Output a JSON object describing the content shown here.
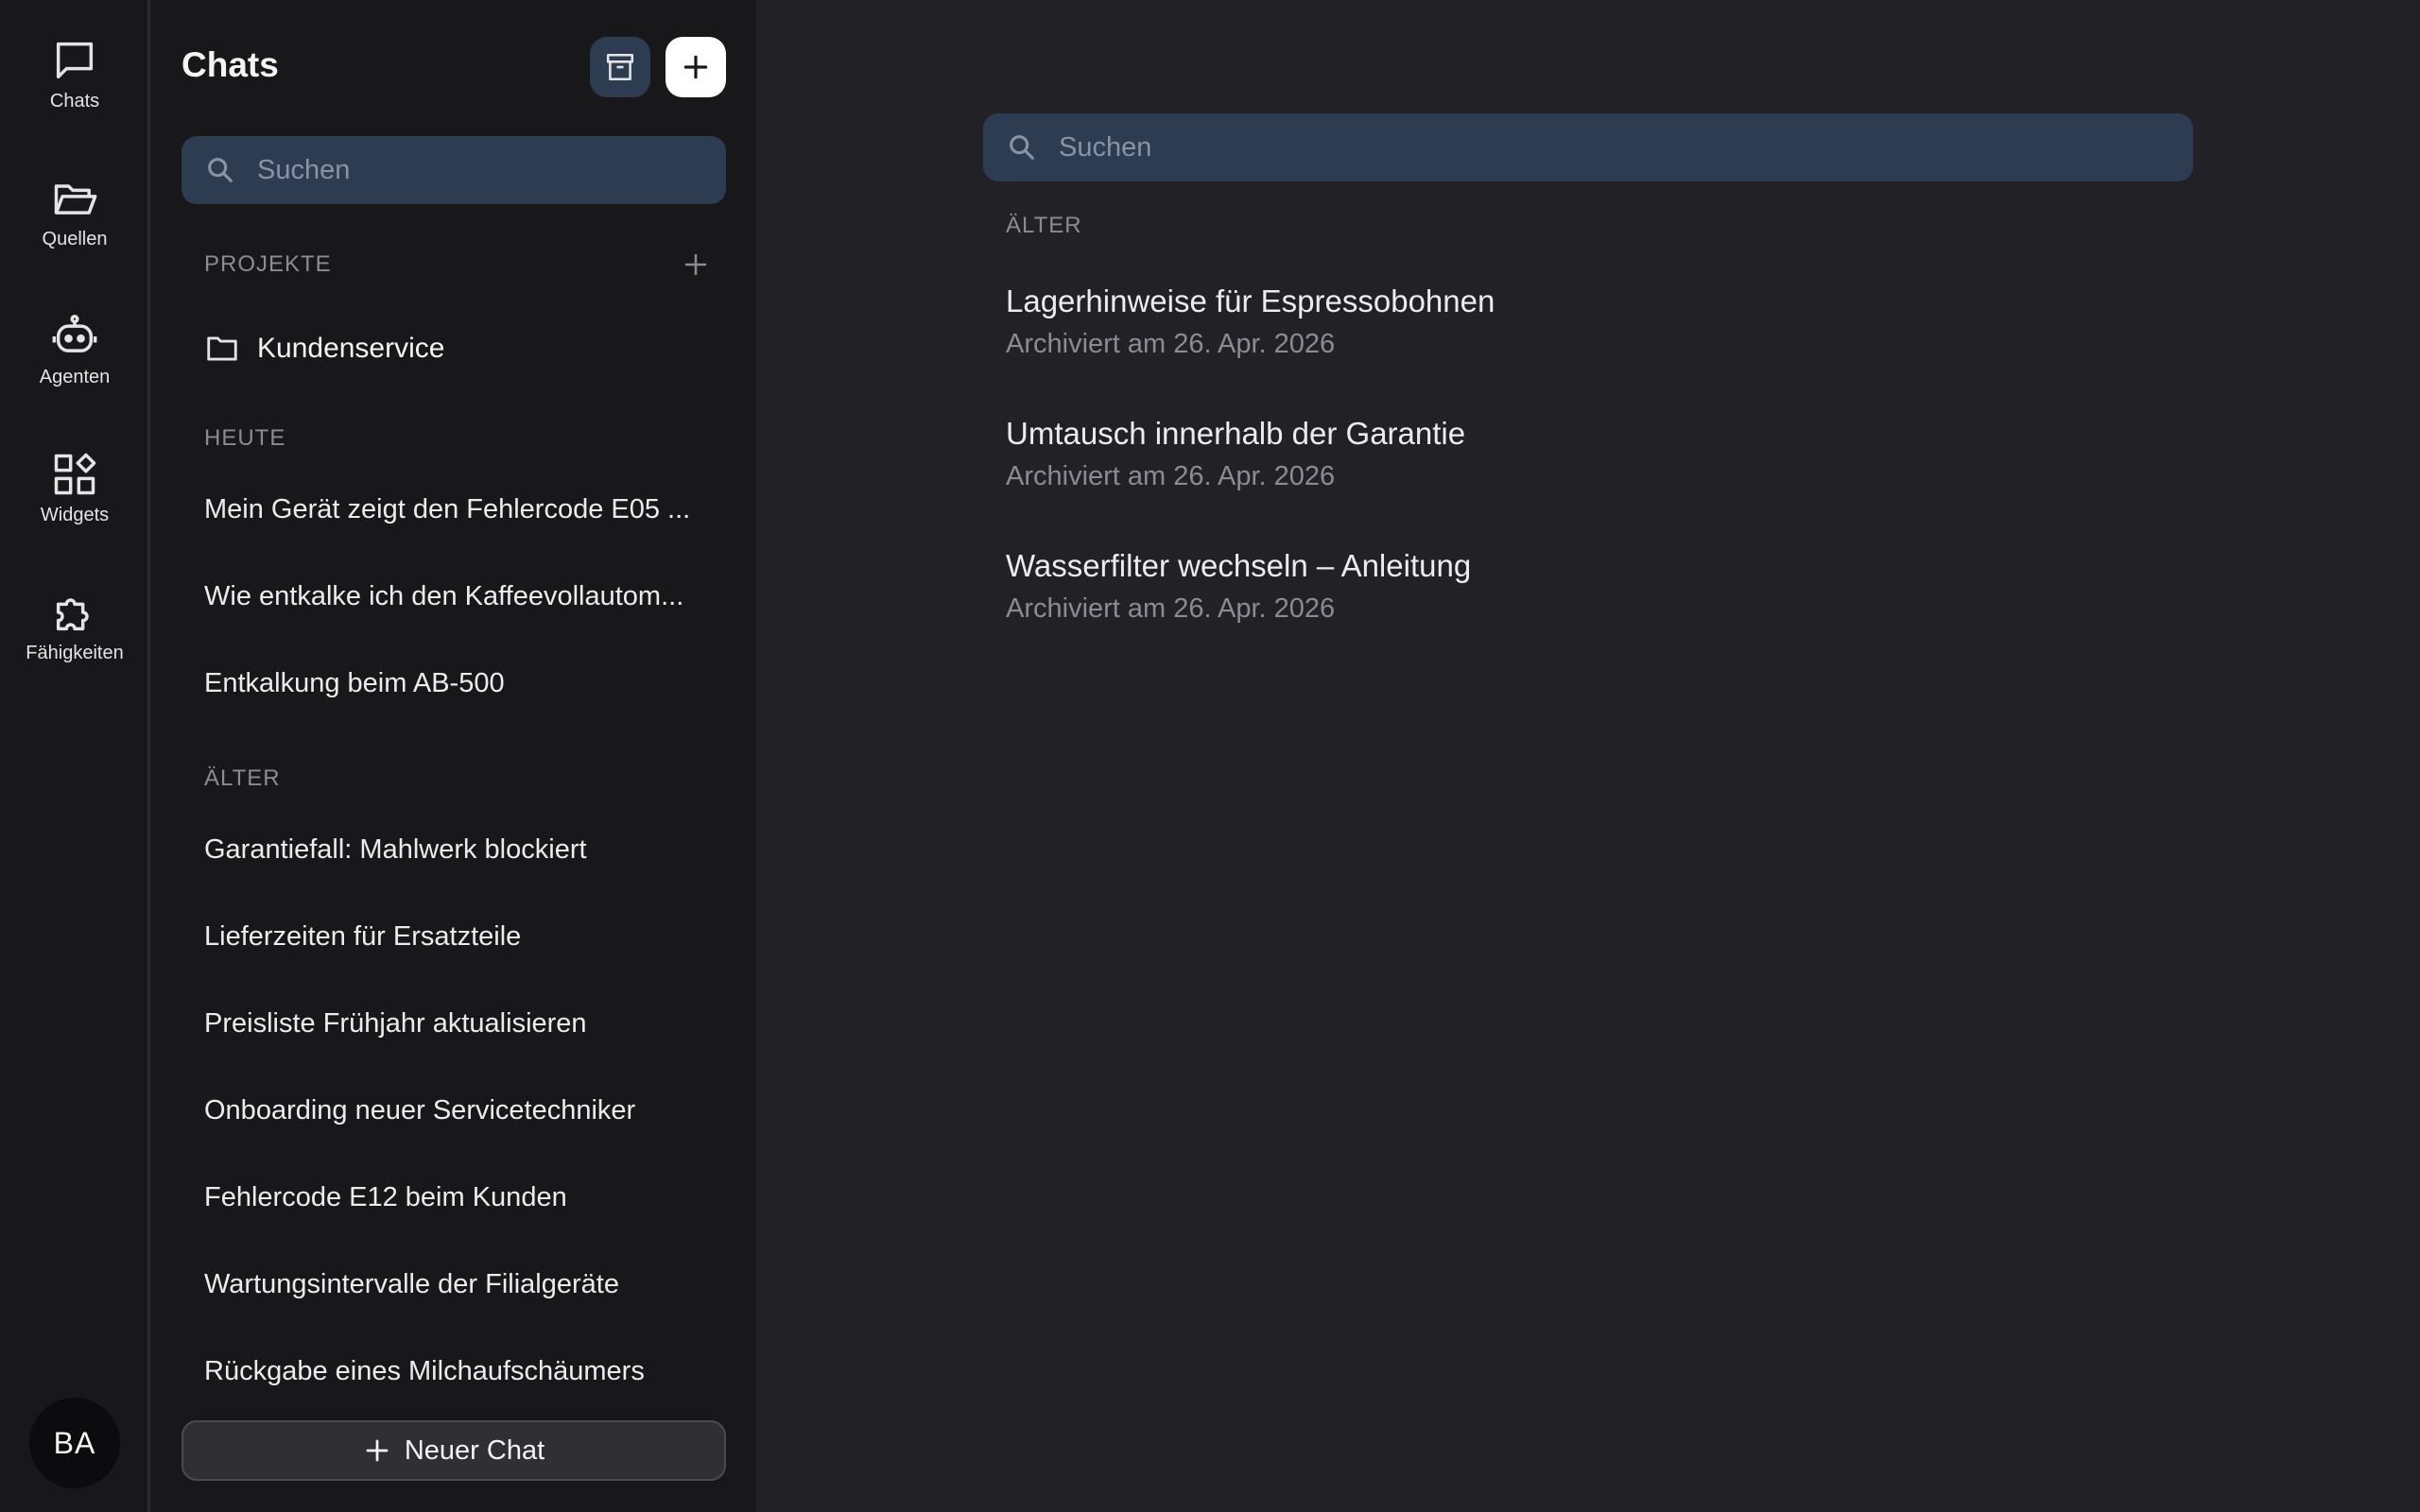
{
  "rail": {
    "items": [
      {
        "label": "Chats",
        "icon": "chat-bubble-icon"
      },
      {
        "label": "Quellen",
        "icon": "folder-open-icon"
      },
      {
        "label": "Agenten",
        "icon": "robot-icon"
      },
      {
        "label": "Widgets",
        "icon": "widgets-icon"
      },
      {
        "label": "Fähigkeiten",
        "icon": "puzzle-icon"
      }
    ],
    "avatar": "BA"
  },
  "sidebar": {
    "title": "Chats",
    "search_placeholder": "Suchen",
    "projects_label": "PROJEKTE",
    "project": "Kundenservice",
    "today_label": "HEUTE",
    "today": [
      "Mein Gerät zeigt den Fehlercode E05 ...",
      "Wie entkalke ich den Kaffeevollautom...",
      "Entkalkung beim AB-500"
    ],
    "older_label": "ÄLTER",
    "older": [
      "Garantiefall: Mahlwerk blockiert",
      "Lieferzeiten für Ersatzteile",
      "Preisliste Frühjahr aktualisieren",
      "Onboarding neuer Servicetechniker",
      "Fehlercode E12 beim Kunden",
      "Wartungsintervalle der Filialgeräte",
      "Rückgabe eines Milchaufschäumers"
    ],
    "new_chat": "Neuer Chat"
  },
  "main": {
    "search_placeholder": "Suchen",
    "section_label": "ÄLTER",
    "archived": [
      {
        "title": "Lagerhinweise für Espressobohnen",
        "subtitle": "Archiviert am 26. Apr. 2026"
      },
      {
        "title": "Umtausch innerhalb der Garantie",
        "subtitle": "Archiviert am 26. Apr. 2026"
      },
      {
        "title": "Wasserfilter wechseln – Anleitung",
        "subtitle": "Archiviert am 26. Apr. 2026"
      }
    ]
  },
  "colors": {
    "background": "#212126",
    "sidebar": "#18181b",
    "search": "#2e3c52",
    "muted_text": "#8b8b93"
  }
}
